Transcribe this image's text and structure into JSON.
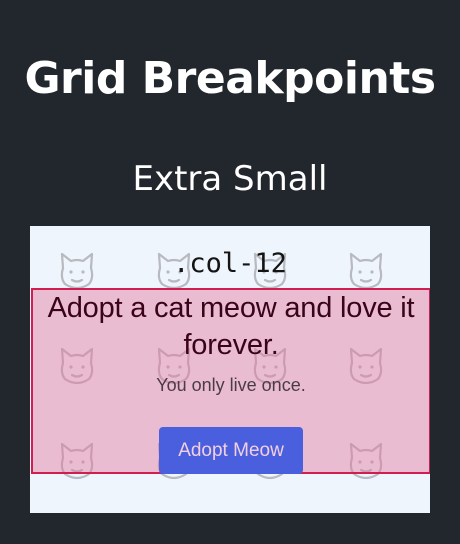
{
  "header": {
    "title": "Grid Breakpoints"
  },
  "section": {
    "title": "Extra Small"
  },
  "demo": {
    "class_label": ".col-12",
    "heading": "Adopt a cat meow and love it forever.",
    "subtext": "You only live once.",
    "button_label": "Adopt Meow",
    "background_icon": "cat-face-icon",
    "colors": {
      "page_bg": "#22262d",
      "demo_bg": "#eef5fc",
      "col_border": "#d11e51",
      "col_fill": "#efb6cc",
      "button_bg": "#4a5fde"
    }
  }
}
